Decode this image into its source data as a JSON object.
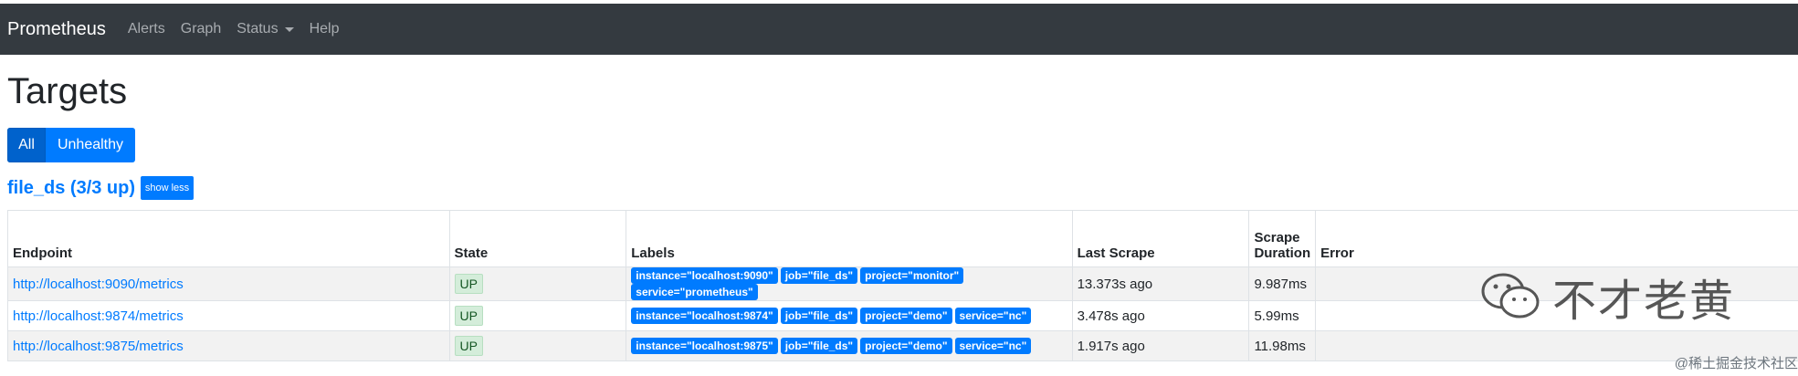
{
  "navbar": {
    "brand": "Prometheus",
    "links": [
      "Alerts",
      "Graph",
      "Status",
      "Help"
    ]
  },
  "page": {
    "title": "Targets",
    "filters": [
      "All",
      "Unhealthy"
    ],
    "active_filter": "All"
  },
  "job": {
    "title": "file_ds (3/3 up)",
    "toggle_label": "show less"
  },
  "table": {
    "headers": {
      "endpoint": "Endpoint",
      "state": "State",
      "labels": "Labels",
      "last_scrape": "Last Scrape",
      "scrape_duration_line1": "Scrape",
      "scrape_duration_line2": "Duration",
      "error": "Error"
    },
    "rows": [
      {
        "endpoint": "http://localhost:9090/metrics",
        "state": "UP",
        "labels": [
          "instance=\"localhost:9090\"",
          "job=\"file_ds\"",
          "project=\"monitor\"",
          "service=\"prometheus\""
        ],
        "last_scrape": "13.373s ago",
        "scrape_duration": "9.987ms",
        "error": ""
      },
      {
        "endpoint": "http://localhost:9874/metrics",
        "state": "UP",
        "labels": [
          "instance=\"localhost:9874\"",
          "job=\"file_ds\"",
          "project=\"demo\"",
          "service=\"nc\""
        ],
        "last_scrape": "3.478s ago",
        "scrape_duration": "5.99ms",
        "error": ""
      },
      {
        "endpoint": "http://localhost:9875/metrics",
        "state": "UP",
        "labels": [
          "instance=\"localhost:9875\"",
          "job=\"file_ds\"",
          "project=\"demo\"",
          "service=\"nc\""
        ],
        "last_scrape": "1.917s ago",
        "scrape_duration": "11.98ms",
        "error": ""
      }
    ]
  },
  "watermark": {
    "icon": "wechat-icon",
    "text": "不才老黄",
    "footer": "@稀土掘金技术社区"
  },
  "colors": {
    "navbar_bg": "#343a40",
    "accent": "#007bff",
    "up_badge_bg": "#d4edda",
    "up_badge_text": "#155724"
  }
}
